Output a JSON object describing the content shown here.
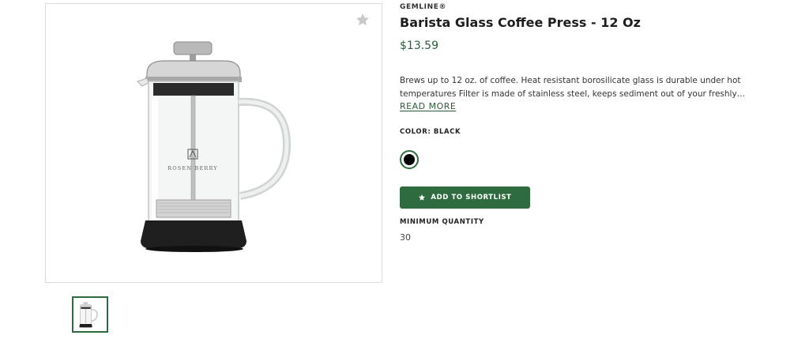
{
  "product": {
    "brand": "GEMLINE®",
    "title": "Barista Glass Coffee Press - 12 Oz",
    "price": "$13.59",
    "description": "Brews up to 12 oz. of coffee. Heat resistant borosilicate glass is durable under hot temperatures Filter is made of stainless steel, keeps sediment out of your freshly…",
    "read_more_label": "READ MORE",
    "color_label": "COLOR: BLACK",
    "selected_color": "#000000",
    "shortlist_label": "ADD TO SHORTLIST",
    "min_qty_label": "MINIMUM QUANTITY",
    "min_qty_value": "30"
  },
  "gallery": {
    "image_brand_text": "ROSEN BERRY",
    "favorite_icon": "star-icon",
    "thumbnail_count": 1
  },
  "colors": {
    "accent": "#2e6b3e",
    "price": "#2a5e3a",
    "border": "#dcdcdc"
  }
}
